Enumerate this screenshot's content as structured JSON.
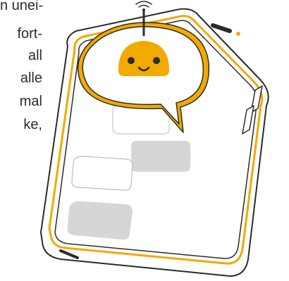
{
  "side_text": {
    "lines": [
      "n unei-",
      "fort-",
      "all",
      "alle",
      "mal",
      "ke,"
    ]
  },
  "colors": {
    "accent": "#F2A900",
    "outline": "#2b2b2b",
    "bubble_fill": "#ffffff",
    "message_gray": "#d6d6d6",
    "phone_fill": "#ffffff"
  },
  "icons": {
    "robot": "robot-face-icon",
    "antenna": "wifi-signal-icon"
  }
}
